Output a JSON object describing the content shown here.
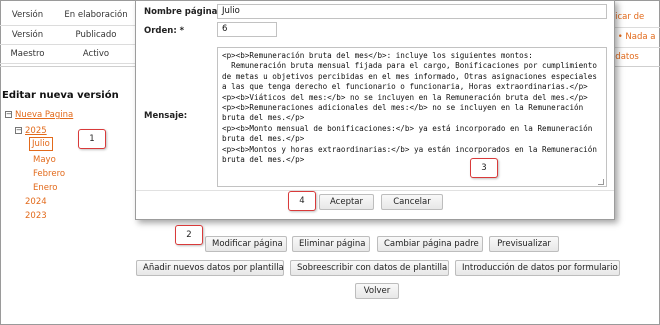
{
  "status_rows": [
    {
      "name": "Versión",
      "state": "En elaboración"
    },
    {
      "name": "Versión",
      "state": "Publicado"
    },
    {
      "name": "Maestro",
      "state": "Activo"
    }
  ],
  "right_links": [
    "ublicar de",
    "ble • Nada a",
    "an datos"
  ],
  "edit_title": "Editar nueva versión",
  "tree": {
    "root": "Nueva Pagina",
    "year_2025": "2025",
    "months": [
      "Julio",
      "Mayo",
      "Febrero",
      "Enero"
    ],
    "year_2024": "2024",
    "year_2023": "2023",
    "toggle_symbol": "−"
  },
  "modal": {
    "page_name_label": "Nombre página: *",
    "page_name_value": "Julio",
    "order_label": "Orden: *",
    "order_value": "6",
    "message_label": "Mensaje:",
    "message_value": "<p><b>Remuneración bruta del mes</b>: incluye los siguientes montos:\n  Remuneración bruta mensual fijada para el cargo, Bonificaciones por cumplimiento de metas u objetivos percibidas en el mes informado, Otras asignaciones especiales a las que tenga derecho el funcionario o funcionaria, Horas extraordinarias.</p>\n<p><b>Viáticos del mes:</b> no se incluyen en la Remuneración bruta del mes.</p>\n<p><b>Remuneraciones adicionales del mes:</b> no se incluyen en la Remuneración bruta del mes.</p>\n<p><b>Monto mensual de bonificaciones:</b> ya está incorporado en la Remuneración bruta del mes.</p>\n<p><b>Montos y horas extraordinarias:</b> ya están incorporados en la Remuneración bruta del mes.</p>",
    "accept_label": "Aceptar",
    "cancel_label": "Cancelar"
  },
  "buttons_row1": [
    "Modificar página",
    "Eliminar página",
    "Cambiar página padre",
    "Previsualizar"
  ],
  "buttons_row2": [
    "Añadir nuevos datos por plantilla",
    "Sobreescribir con datos de plantilla",
    "Introducción de datos por formulario"
  ],
  "back_label": "Volver",
  "markers": [
    "1",
    "2",
    "3",
    "4"
  ],
  "colors": {
    "link": "#e26a1b",
    "marker_border": "#d93a3a"
  }
}
